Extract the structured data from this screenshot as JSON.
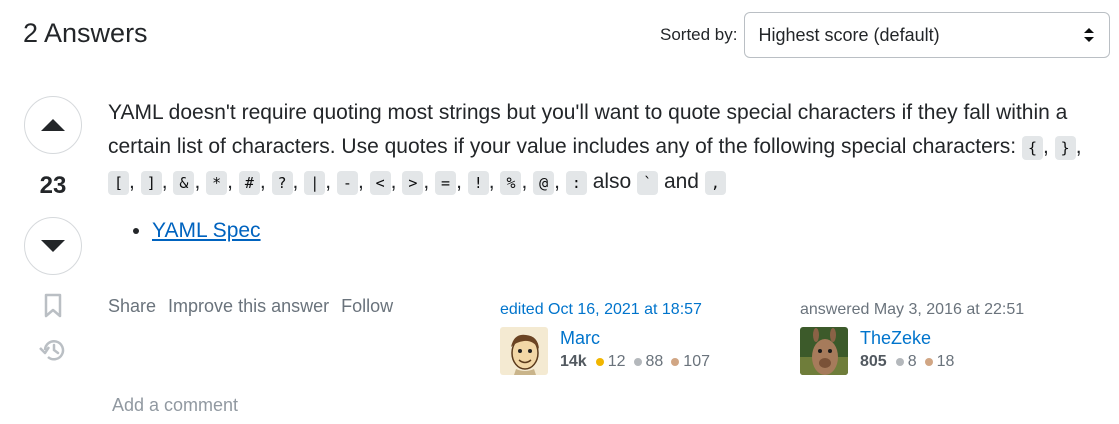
{
  "header": {
    "answers_count_label": "2 Answers",
    "sort_label": "Sorted by:",
    "sort_value": "Highest score (default)"
  },
  "vote": {
    "score": "23"
  },
  "answer": {
    "text_intro": "YAML doesn't require quoting most strings but you'll want to quote special characters if they fall within a certain list of characters. Use quotes if your value includes any of the following special characters: ",
    "special_chars": [
      "{",
      "}",
      "[",
      "]",
      "&",
      "*",
      "#",
      "?",
      "|",
      "-",
      "<",
      ">",
      "=",
      "!",
      "%",
      "@",
      ":"
    ],
    "separator": ", ",
    "also_text": " also ",
    "also_char": "`",
    "and_text": " and ",
    "last_char": ",",
    "links": [
      {
        "label": "YAML Spec"
      }
    ]
  },
  "post_menu": {
    "share": "Share",
    "improve": "Improve this answer",
    "follow": "Follow"
  },
  "edited": {
    "action": "edited Oct 16, 2021 at 18:57",
    "user": "Marc",
    "reputation": "14k",
    "gold": "12",
    "silver": "88",
    "bronze": "107"
  },
  "answered": {
    "action": "answered May 3, 2016 at 22:51",
    "user": "TheZeke",
    "reputation": "805",
    "silver": "8",
    "bronze": "18"
  },
  "comments": {
    "add_label": "Add a comment"
  },
  "colors": {
    "link": "#0074cc",
    "gold": "#f1b600",
    "silver": "#b4b8bc",
    "bronze": "#d1a684"
  }
}
